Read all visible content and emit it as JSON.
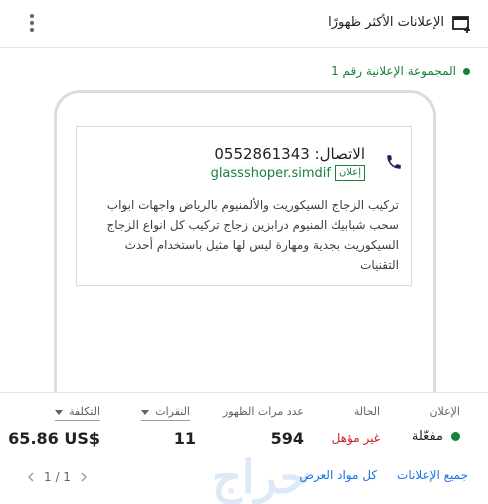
{
  "header": {
    "title": "الإعلانات الأكثر ظهورًا",
    "add_icon": "add-to-queue-icon",
    "menu_icon": "more-vert-icon"
  },
  "group": {
    "label": "المجموعة الإعلانية رقم 1",
    "status_color": "#188038"
  },
  "ad": {
    "phone_line": "الاتصال: 0552861343",
    "badge": "إعلان",
    "url": "glassshoper.simdif",
    "description": "تركيب الزجاج السيكوريت والألمنيوم بالرياض واجهات ابواب سحب شبابيك المنيوم درابزين زجاج تركيب كل انواع الزجاج السيكوريت بجدية ومهارة ليس لها مثيل باستخدام أحدث التقنيات",
    "phone_icon": "phone-icon"
  },
  "stats": {
    "headers": {
      "ad": "الإعلان",
      "status": "الحالة",
      "impressions": "عدد مرات الظهور",
      "clicks": "النقرات",
      "cost": "التكلفة"
    },
    "values": {
      "ad": "مفعّلة",
      "status": "غير مؤهل",
      "impressions": "594",
      "clicks": "11",
      "cost": "65.86 US$"
    }
  },
  "pager": {
    "text": "1 / 1"
  },
  "footer": {
    "all_ads": "جميع الإعلانات",
    "all_assets": "كل مواد العرض"
  },
  "watermark": "حراج",
  "colors": {
    "accent": "#1a73e8",
    "enabled": "#188038",
    "error": "#c5221f"
  }
}
